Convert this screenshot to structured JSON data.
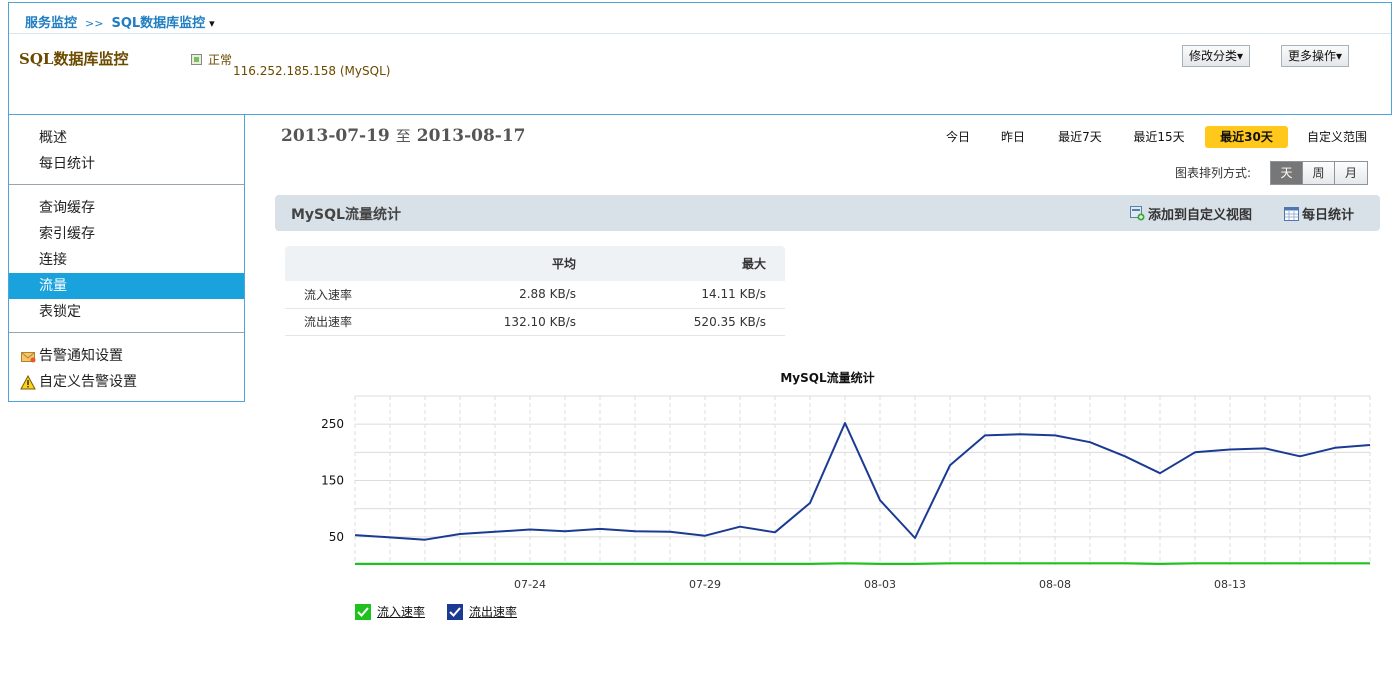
{
  "breadcrumb": {
    "item1": "服务监控",
    "sep": ">>",
    "item2": "SQL数据库监控",
    "caret": "▾"
  },
  "header": {
    "title": "SQL数据库监控",
    "status": "正常",
    "host": "116.252.185.158 (MySQL)",
    "modify_category": "修改分类▾",
    "more_actions": "更多操作▾"
  },
  "sidebar": {
    "group1": [
      "概述",
      "每日统计"
    ],
    "group2": [
      "查询缓存",
      "索引缓存",
      "连接",
      "流量",
      "表锁定"
    ],
    "group3": [
      "告警通知设置",
      "自定义告警设置"
    ],
    "active": "流量"
  },
  "date_range": {
    "start": "2013-07-19",
    "to": "至",
    "end": "2013-08-17"
  },
  "range_buttons": [
    "今日",
    "昨日",
    "最近7天",
    "最近15天",
    "最近30天",
    "自定义范围"
  ],
  "active_range": "最近30天",
  "order": {
    "label": "图表排列方式:",
    "options": [
      "天",
      "周",
      "月"
    ],
    "active": "天"
  },
  "panel": {
    "title": "MySQL流量统计",
    "add_view": "添加到自定义视图",
    "daily_stats": "每日统计"
  },
  "stats_table": {
    "headers": [
      "",
      "平均",
      "最大"
    ],
    "rows": [
      {
        "label": "流入速率",
        "avg": "2.88 KB/s",
        "max": "14.11 KB/s"
      },
      {
        "label": "流出速率",
        "avg": "132.10 KB/s",
        "max": "520.35 KB/s"
      }
    ]
  },
  "colors": {
    "accent": "#1aa2dd",
    "active_range": "#ffc81a",
    "series_in": "#1fc11f",
    "series_out": "#1b3a93"
  },
  "chart_data": {
    "type": "line",
    "title": "MySQL流量统计",
    "x_tick_labels": [
      "07-24",
      "07-29",
      "08-03",
      "08-08",
      "08-13"
    ],
    "y_tick_labels": [
      "50",
      "150",
      "250"
    ],
    "ylim": [
      0,
      300
    ],
    "x": [
      "07-19",
      "07-20",
      "07-21",
      "07-22",
      "07-23",
      "07-24",
      "07-25",
      "07-26",
      "07-27",
      "07-28",
      "07-29",
      "07-30",
      "07-31",
      "08-01",
      "08-02",
      "08-03",
      "08-04",
      "08-05",
      "08-06",
      "08-07",
      "08-08",
      "08-09",
      "08-10",
      "08-11",
      "08-12",
      "08-13",
      "08-14",
      "08-15",
      "08-16",
      "08-17"
    ],
    "series": [
      {
        "name": "流入速率",
        "color": "#1fc11f",
        "values": [
          2,
          2,
          2,
          2,
          2,
          2,
          2,
          2,
          2,
          2,
          2,
          2,
          2,
          2,
          3,
          2,
          2,
          3,
          3,
          3,
          3,
          3,
          3,
          2,
          3,
          3,
          3,
          3,
          3,
          3
        ]
      },
      {
        "name": "流出速率",
        "color": "#1b3a93",
        "values": [
          53,
          49,
          45,
          55,
          59,
          63,
          60,
          64,
          60,
          59,
          52,
          68,
          58,
          110,
          252,
          115,
          48,
          177,
          230,
          232,
          230,
          218,
          193,
          163,
          200,
          205,
          207,
          193,
          208,
          213
        ]
      }
    ],
    "legend": "bottom-left",
    "grid": true
  }
}
